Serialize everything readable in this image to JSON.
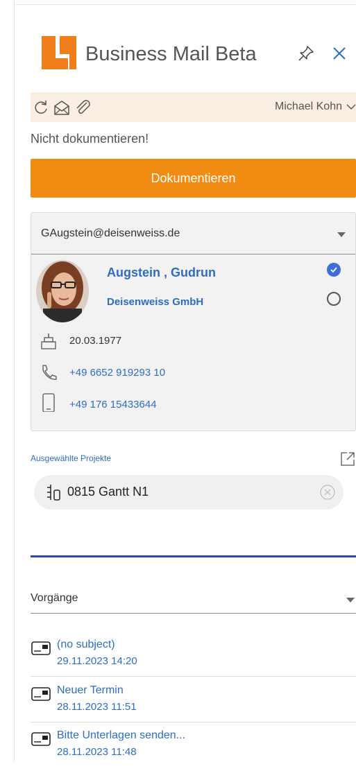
{
  "header": {
    "app_title": "Business Mail Beta"
  },
  "toolbar": {
    "user_name": "Michael Kohn"
  },
  "status_text": "Nicht dokumentieren!",
  "document_button_label": "Dokumentieren",
  "contact": {
    "email": "GAugstein@deisenweiss.de",
    "name": "Augstein , Gudrun",
    "company": "Deisenweiss GmbH",
    "birthday": "20.03.1977",
    "phone": "+49 6652 919293 10",
    "mobile": "+49 176 15433644"
  },
  "projects": {
    "label": "Ausgewählte Projekte",
    "items": [
      {
        "label": "0815 Gantt N1"
      }
    ]
  },
  "processes": {
    "label": "Vorgänge",
    "items": [
      {
        "title": "(no subject)",
        "date": "29.11.2023 14:20"
      },
      {
        "title": "Neuer Termin",
        "date": "28.11.2023 11:51"
      },
      {
        "title": "Bitte Unterlagen senden...",
        "date": "28.11.2023 11:48"
      }
    ]
  },
  "colors": {
    "accent": "#f08c12",
    "link": "#2e6dbf",
    "toolbar_bg": "#fbeee3",
    "divider": "#2f47a8"
  }
}
